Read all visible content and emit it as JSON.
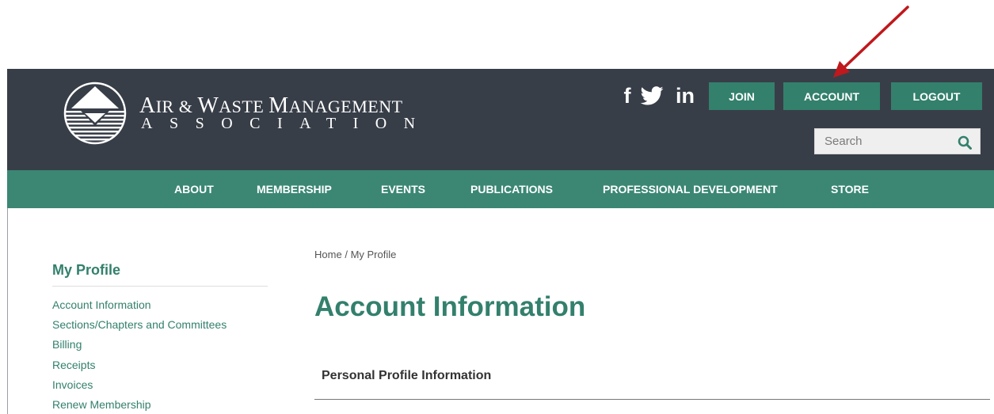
{
  "brand": {
    "title_initial_1": "A",
    "title_rest_1": "IR & ",
    "title_initial_2": "W",
    "title_rest_2": "ASTE ",
    "title_initial_3": "M",
    "title_rest_3": "ANAGEMENT",
    "subtitle": "ASSOCIATION"
  },
  "social": {
    "facebook_glyph": "f",
    "linkedin_glyph": "in",
    "icons": [
      "facebook-icon",
      "twitter-icon",
      "linkedin-icon"
    ]
  },
  "top_buttons": {
    "join": "JOIN",
    "account": "ACCOUNT",
    "logout": "LOGOUT"
  },
  "search": {
    "placeholder": "Search"
  },
  "nav": {
    "items": [
      "ABOUT",
      "MEMBERSHIP",
      "EVENTS",
      "PUBLICATIONS",
      "PROFESSIONAL DEVELOPMENT",
      "STORE"
    ]
  },
  "sidebar": {
    "title": "My Profile",
    "links": [
      "Account Information",
      "Sections/Chapters and Committees",
      "Billing",
      "Receipts",
      "Invoices",
      "Renew Membership"
    ]
  },
  "breadcrumb": {
    "home": "Home",
    "separator": "/",
    "current": "My Profile"
  },
  "main": {
    "title": "Account Information",
    "section_heading": "Personal Profile Information"
  },
  "colors": {
    "header_bg": "#383e48",
    "nav_bg": "#3b8774",
    "accent": "#33806c",
    "annotation_arrow": "#c0181c"
  }
}
